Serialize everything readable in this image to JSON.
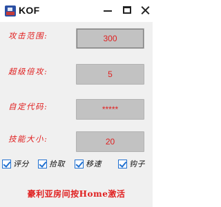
{
  "window": {
    "title": "KOF",
    "icon": "app-game-icon",
    "controls": {
      "minimize_icon": "minimize-icon",
      "maximize_icon": "maximize-icon",
      "close_icon": "close-icon"
    }
  },
  "fields": [
    {
      "label": "攻击范围:",
      "value": "300"
    },
    {
      "label": "超级倍攻:",
      "value": "5"
    },
    {
      "label": "自定代码:",
      "value": "*****"
    },
    {
      "label": "技能大小:",
      "value": "20"
    }
  ],
  "checkboxes": [
    {
      "label": "评分",
      "checked": true
    },
    {
      "label": "拾取",
      "checked": true
    },
    {
      "label": "移速",
      "checked": true
    },
    {
      "label": "钩子",
      "checked": true
    }
  ],
  "footer": {
    "text": "豪利亚房间按Home激活"
  },
  "colors": {
    "accent": "#e02020",
    "input_bg": "#c2c2c2",
    "client_bg": "#f0f0f0",
    "checkbox": "#1e6fd0"
  }
}
